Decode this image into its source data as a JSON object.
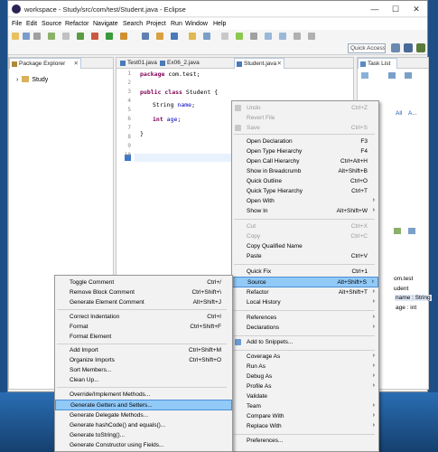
{
  "colors": {
    "desktop": "#1d4f86",
    "menu_bg": "#f2f2f2",
    "highlight": "#91c9f7",
    "keyword": "#7f0055",
    "field": "#0000c0"
  },
  "window": {
    "title": "workspace - Study/src/com/test/Student.java - Eclipse",
    "minimize": "—",
    "maximize": "☐",
    "close": "✕"
  },
  "menubar": [
    "File",
    "Edit",
    "Source",
    "Refactor",
    "Navigate",
    "Search",
    "Project",
    "Run",
    "Window",
    "Help"
  ],
  "toolbar": {
    "quick_access": "Quick Access"
  },
  "package_explorer": {
    "tab": "Package Explorer",
    "close": "✕",
    "project": "Study",
    "twisty": "›"
  },
  "editor": {
    "tabs": [
      {
        "label": "Test01.java"
      },
      {
        "label": "Ex06_2.java"
      },
      {
        "label": "Student.java",
        "close": "✕"
      }
    ],
    "line_numbers": [
      "1",
      "2",
      "3",
      "4",
      "5",
      "6",
      "7",
      "8",
      "9",
      "10"
    ],
    "lines": {
      "l1_kw": "package",
      "l1_rest": " com.test;",
      "l3_kw1": "public",
      "l3_kw2": " class",
      "l3_rest": " Student {",
      "l5_type": "String ",
      "l5_field": "name",
      "l5_rest": ";",
      "l7_kw": "int",
      "l7_field": " age",
      "l7_rest": ";",
      "l9": "}"
    }
  },
  "task_list": {
    "tab": "Task List",
    "filter_all": "All",
    "filter_a": "A...",
    "outline_pkg": "om.test",
    "outline_class": "udent",
    "outline_name": "name : String",
    "outline_age": "age : int"
  },
  "context_menu": [
    {
      "label": "Undo",
      "shortcut": "Ctrl+Z",
      "disabled": true
    },
    {
      "label": "Revert File",
      "shortcut": "",
      "disabled": true
    },
    {
      "label": "Save",
      "shortcut": "Ctrl+S",
      "disabled": true
    },
    {
      "label": "Open Declaration",
      "shortcut": "F3"
    },
    {
      "label": "Open Type Hierarchy",
      "shortcut": "F4"
    },
    {
      "label": "Open Call Hierarchy",
      "shortcut": "Ctrl+Alt+H"
    },
    {
      "label": "Show in Breadcrumb",
      "shortcut": "Alt+Shift+B"
    },
    {
      "label": "Quick Outline",
      "shortcut": "Ctrl+O"
    },
    {
      "label": "Quick Type Hierarchy",
      "shortcut": "Ctrl+T"
    },
    {
      "label": "Open With",
      "shortcut": "",
      "submenu": "›"
    },
    {
      "label": "Show In",
      "shortcut": "Alt+Shift+W",
      "submenu": "›"
    },
    {
      "label": "Cut",
      "shortcut": "Ctrl+X",
      "disabled": true
    },
    {
      "label": "Copy",
      "shortcut": "Ctrl+C",
      "disabled": true
    },
    {
      "label": "Copy Qualified Name",
      "shortcut": ""
    },
    {
      "label": "Paste",
      "shortcut": "Ctrl+V"
    },
    {
      "label": "Quick Fix",
      "shortcut": "Ctrl+1"
    },
    {
      "label": "Source",
      "shortcut": "Alt+Shift+S",
      "submenu": "›",
      "highlighted": true
    },
    {
      "label": "Refactor",
      "shortcut": "Alt+Shift+T",
      "submenu": "›"
    },
    {
      "label": "Local History",
      "shortcut": "",
      "submenu": "›"
    },
    {
      "label": "References",
      "shortcut": "",
      "submenu": "›"
    },
    {
      "label": "Declarations",
      "shortcut": "",
      "submenu": "›"
    },
    {
      "label": "Add to Snippets...",
      "shortcut": ""
    },
    {
      "label": "Coverage As",
      "shortcut": "",
      "submenu": "›"
    },
    {
      "label": "Run As",
      "shortcut": "",
      "submenu": "›"
    },
    {
      "label": "Debug As",
      "shortcut": "",
      "submenu": "›"
    },
    {
      "label": "Profile As",
      "shortcut": "",
      "submenu": "›"
    },
    {
      "label": "Validate",
      "shortcut": ""
    },
    {
      "label": "Team",
      "shortcut": "",
      "submenu": "›"
    },
    {
      "label": "Compare With",
      "shortcut": "",
      "submenu": "›"
    },
    {
      "label": "Replace With",
      "shortcut": "",
      "submenu": "›"
    },
    {
      "label": "Preferences...",
      "shortcut": ""
    }
  ],
  "source_menu": [
    {
      "label": "Toggle Comment",
      "shortcut": "Ctrl+/"
    },
    {
      "label": "Remove Block Comment",
      "shortcut": "Ctrl+Shift+\\"
    },
    {
      "label": "Generate Element Comment",
      "shortcut": "Alt+Shift+J"
    },
    {
      "label": "Correct Indentation",
      "shortcut": "Ctrl+I"
    },
    {
      "label": "Format",
      "shortcut": "Ctrl+Shift+F"
    },
    {
      "label": "Format Element",
      "shortcut": ""
    },
    {
      "label": "Add Import",
      "shortcut": "Ctrl+Shift+M"
    },
    {
      "label": "Organize Imports",
      "shortcut": "Ctrl+Shift+O"
    },
    {
      "label": "Sort Members...",
      "shortcut": ""
    },
    {
      "label": "Clean Up...",
      "shortcut": ""
    },
    {
      "label": "Override/Implement Methods...",
      "shortcut": ""
    },
    {
      "label": "Generate Getters and Setters...",
      "shortcut": "",
      "highlighted": true
    },
    {
      "label": "Generate Delegate Methods...",
      "shortcut": ""
    },
    {
      "label": "Generate hashCode() and equals()...",
      "shortcut": ""
    },
    {
      "label": "Generate toString()...",
      "shortcut": ""
    },
    {
      "label": "Generate Constructor using Fields...",
      "shortcut": ""
    }
  ]
}
